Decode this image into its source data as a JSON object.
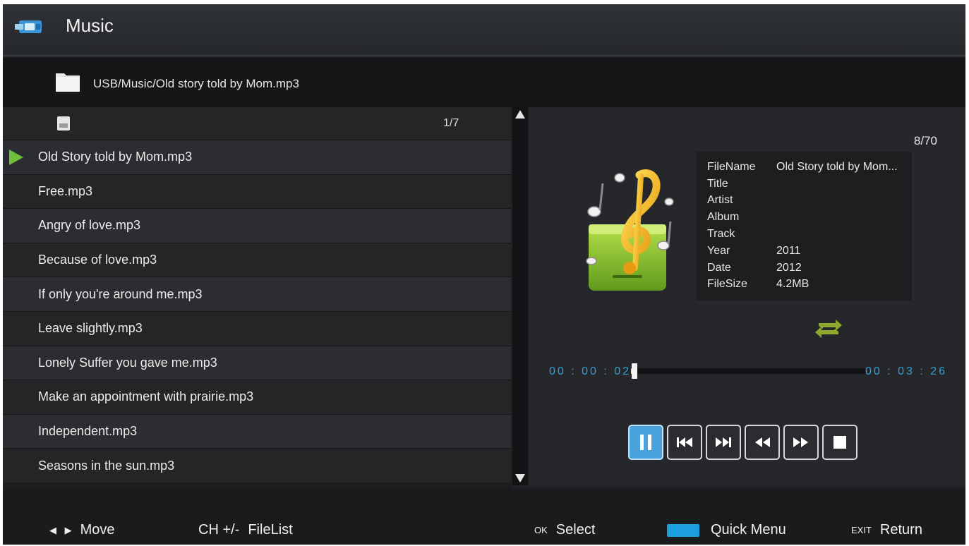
{
  "header": {
    "title": "Music",
    "icon": "usb-media-icon"
  },
  "path": {
    "icon": "folder-icon",
    "text": "USB/Music/Old story told by Mom.mp3"
  },
  "file_list": {
    "page": "1/7",
    "items": [
      {
        "label": "Old Story told by Mom.mp3",
        "playing": true
      },
      {
        "label": "Free.mp3"
      },
      {
        "label": "Angry of love.mp3"
      },
      {
        "label": "Because of love.mp3"
      },
      {
        "label": "If only you're around me.mp3"
      },
      {
        "label": "Leave slightly.mp3"
      },
      {
        "label": "Lonely Suffer you gave me.mp3"
      },
      {
        "label": "Make an appointment with prairie.mp3"
      },
      {
        "label": "Independent.mp3"
      },
      {
        "label": "Seasons in the sun.mp3"
      }
    ]
  },
  "info": {
    "index": "8/70",
    "meta": [
      {
        "key": "FileName",
        "value": "Old Story told by Mom..."
      },
      {
        "key": "Title",
        "value": ""
      },
      {
        "key": "Artist",
        "value": ""
      },
      {
        "key": "Album",
        "value": ""
      },
      {
        "key": "Track",
        "value": ""
      },
      {
        "key": "Year",
        "value": "2011"
      },
      {
        "key": "Date",
        "value": "2012"
      },
      {
        "key": "FileSize",
        "value": "4.2MB"
      }
    ]
  },
  "playback": {
    "current_time": "00 : 00 : 02",
    "total_time": "00 : 03 : 26",
    "progress": 0.01,
    "controls": [
      "pause-icon",
      "previous-track-icon",
      "next-track-icon",
      "rewind-icon",
      "fast-forward-icon",
      "stop-icon"
    ]
  },
  "footer": {
    "move_label": "Move",
    "filelist_key": "CH +/-",
    "filelist_label": "FileList",
    "select_key": "OK",
    "select_label": "Select",
    "menu_label": "Quick Menu",
    "exit_key": "EXIT",
    "return_label": "Return"
  },
  "colors": {
    "accent_blue": "#1d9ee0",
    "time_text": "#2f9fd6",
    "play_marker": "#6fbf3a",
    "repeat_icon": "#8fa92e"
  }
}
